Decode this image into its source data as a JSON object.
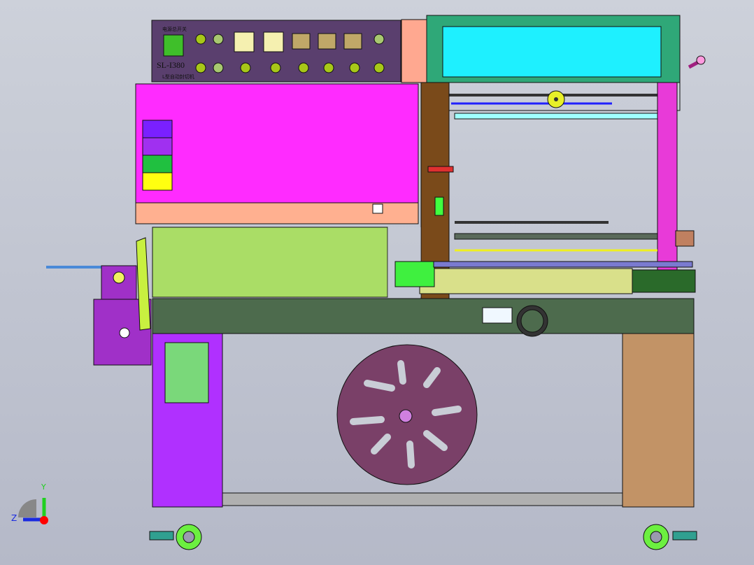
{
  "control_panel": {
    "power_switch_label": "电源总开关",
    "model": "SL-I380",
    "machine_name": "L型自动封切机",
    "colors": {
      "panel": "#5a3f6e",
      "switch": "#3fbf2a",
      "lamp": "#a8c860",
      "display": "#f5f0b0",
      "button_box": "#c0a868"
    }
  },
  "axis_triad": {
    "y_label": "Y",
    "z_label": "Z"
  },
  "colors": {
    "hood": "#ff2bff",
    "frame": "#4d6b4d",
    "left_leg": "#b030ff",
    "right_leg": "#c29366",
    "cover": "#aadd66",
    "film_disc": "#7a4068",
    "top_window": "#1ef0ff"
  }
}
